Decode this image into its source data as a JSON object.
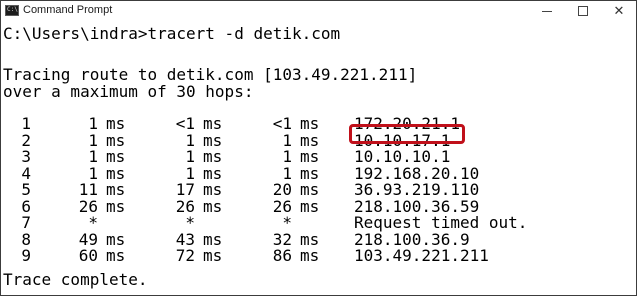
{
  "window": {
    "title": "Command Prompt",
    "icon": "cmd-icon",
    "controls": {
      "minimize": "minimize-icon",
      "maximize": "maximize-icon",
      "close": "close-icon"
    }
  },
  "console": {
    "command_line": "C:\\Users\\indra>tracert -d detik.com",
    "tracing_line": "Tracing route to detik.com [103.49.221.211]",
    "max_hops_line": "over a maximum of 30 hops:",
    "hops": [
      {
        "hop": "1",
        "rtt1": "1",
        "rtt2": "<1",
        "rtt3": "<1",
        "host": "172.20.21.1"
      },
      {
        "hop": "2",
        "rtt1": "1",
        "rtt2": "1",
        "rtt3": "1",
        "host": "10.10.17.1"
      },
      {
        "hop": "3",
        "rtt1": "1",
        "rtt2": "1",
        "rtt3": "1",
        "host": "10.10.10.1"
      },
      {
        "hop": "4",
        "rtt1": "1",
        "rtt2": "1",
        "rtt3": "1",
        "host": "192.168.20.10"
      },
      {
        "hop": "5",
        "rtt1": "11",
        "rtt2": "17",
        "rtt3": "20",
        "host": "36.93.219.110"
      },
      {
        "hop": "6",
        "rtt1": "26",
        "rtt2": "26",
        "rtt3": "26",
        "host": "218.100.36.59"
      },
      {
        "hop": "7",
        "rtt1": "*",
        "rtt2": "*",
        "rtt3": "*",
        "host": "Request timed out."
      },
      {
        "hop": "8",
        "rtt1": "49",
        "rtt2": "43",
        "rtt3": "32",
        "host": "218.100.36.9"
      },
      {
        "hop": "9",
        "rtt1": "60",
        "rtt2": "72",
        "rtt3": "86",
        "host": "103.49.221.211"
      }
    ],
    "unit": "ms",
    "complete_line": "Trace complete."
  },
  "colors": {
    "highlight": "#c0101a",
    "text": "#000000",
    "background": "#ffffff"
  }
}
